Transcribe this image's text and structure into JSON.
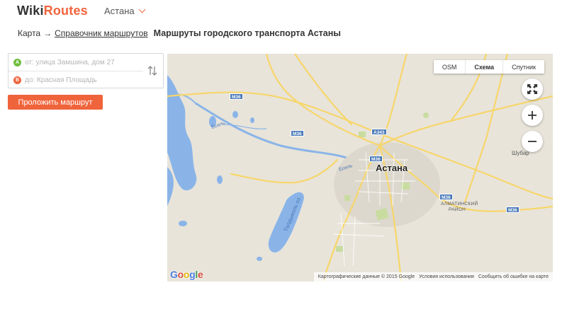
{
  "header": {
    "logo_part1": "Wiki",
    "logo_part2": "Routes",
    "city": "Астана",
    "brand_color": "#f0643c"
  },
  "breadcrumb": {
    "home": "Карта",
    "arrow": "→",
    "directory": "Справочник маршрутов",
    "current": "Маршруты городского транспорта Астаны"
  },
  "route_form": {
    "from_marker": "A",
    "from_placeholder": "от: улица Замшина, дом 27",
    "to_marker": "B",
    "to_placeholder": "до: Красная Площадь",
    "build_button": "Проложить маршрут"
  },
  "map": {
    "types": [
      {
        "label": "OSM",
        "active": false
      },
      {
        "label": "Схема",
        "active": true
      },
      {
        "label": "Спутник",
        "active": false
      }
    ],
    "city_label": "Астана",
    "labels": {
      "district_1": "АЛМАТИНСКИЙ",
      "district_2": "РАЙОН",
      "village": "Шубар",
      "river_esil_1": "Есиль",
      "river_esil_2": "Есиль",
      "lake": "Талдыколь оз."
    },
    "shields": {
      "m36_a": "M36",
      "m36_b": "M36",
      "m36_c": "M36",
      "m36_d": "M36",
      "m36_e": "M36",
      "a343": "A343"
    },
    "logo": {
      "g1": "G",
      "g2": "o",
      "g3": "o",
      "g4": "g",
      "g5": "l",
      "g6": "e"
    },
    "attribution": {
      "data": "Картографические данные © 2015 Google",
      "terms": "Условия использования",
      "report": "Сообщить об ошибке на карте"
    },
    "colors": {
      "land": "#e8e4da",
      "water": "#8ab4e8",
      "road": "#f7d66a",
      "park": "#c8dca0"
    }
  }
}
